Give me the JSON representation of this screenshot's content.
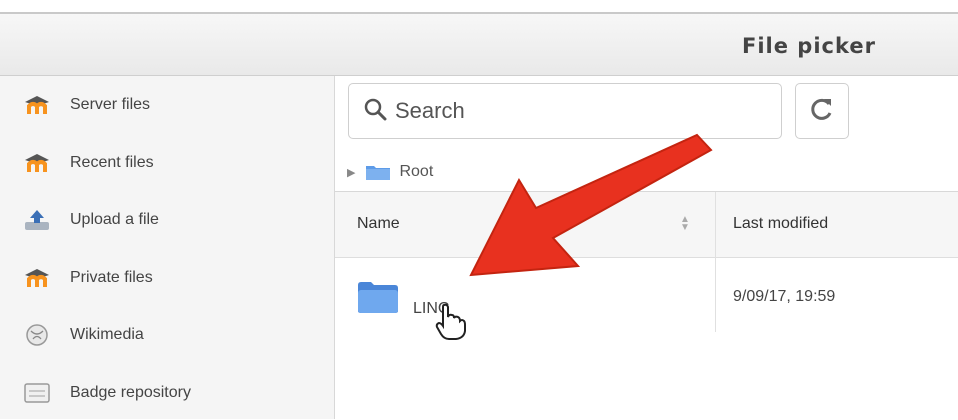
{
  "dialog": {
    "title": "File picker"
  },
  "sidebar": {
    "items": [
      {
        "label": "Server files",
        "icon": "moodle-icon"
      },
      {
        "label": "Recent files",
        "icon": "moodle-icon"
      },
      {
        "label": "Upload a file",
        "icon": "upload-icon"
      },
      {
        "label": "Private files",
        "icon": "moodle-icon"
      },
      {
        "label": "Wikimedia",
        "icon": "wikimedia-icon"
      },
      {
        "label": "Badge repository",
        "icon": "badge-repository-icon"
      }
    ]
  },
  "toolbar": {
    "search_label": "Search",
    "refresh_icon": "refresh-icon"
  },
  "breadcrumb": {
    "root": "Root"
  },
  "table": {
    "columns": [
      "Name",
      "Last modified"
    ],
    "rows": [
      {
        "name": "LINC",
        "modified": "9/09/17, 19:59"
      }
    ]
  },
  "colors": {
    "arrow": "#e8311f",
    "moodle_orange": "#f7931e",
    "folder_blue": "#5d9be8"
  }
}
